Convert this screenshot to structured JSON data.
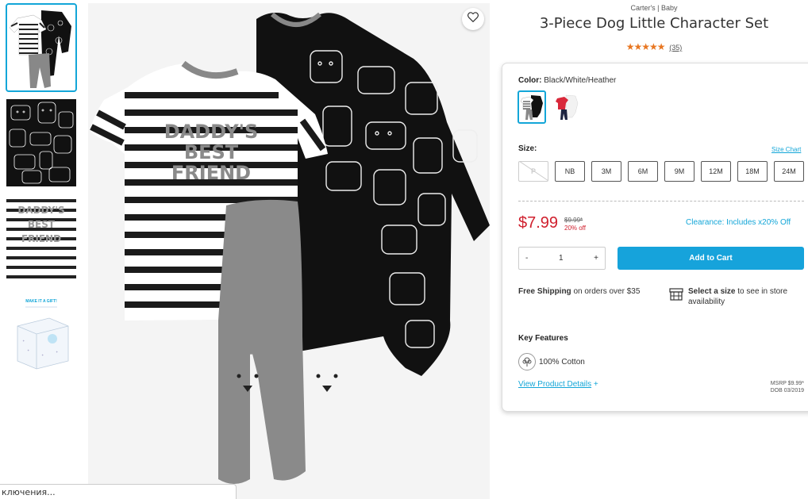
{
  "brand_line": "Carter's | Baby",
  "product": {
    "title": "3-Piece Dog Little Character Set",
    "stars": "★★★★★",
    "review_count": "(35)",
    "shirt_print": [
      "DADDY'S",
      "BEST",
      "FRIEND"
    ]
  },
  "thumbnails": [
    {
      "name": "thumb-set",
      "selected": true
    },
    {
      "name": "thumb-dog-print"
    },
    {
      "name": "thumb-shirt-print"
    },
    {
      "name": "thumb-gift-box",
      "caption": "MAKE IT A GIFT!"
    }
  ],
  "color": {
    "label": "Color:",
    "value": "Black/White/Heather"
  },
  "size": {
    "label": "Size:",
    "chart_link": "Size Chart",
    "options": [
      "P",
      "NB",
      "3M",
      "6M",
      "9M",
      "12M",
      "18M",
      "24M"
    ]
  },
  "pricing": {
    "price": "$7.99",
    "original": "$9.99*",
    "discount": "20% off",
    "clearance": "Clearance: Includes x20% Off"
  },
  "quantity": {
    "minus": "-",
    "value": "1",
    "plus": "+"
  },
  "add_to_cart": "Add to Cart",
  "shipping": {
    "bold": "Free Shipping",
    "rest": " on orders over $35"
  },
  "store": {
    "bold": "Select a size",
    "rest": " to see in store availability"
  },
  "features": {
    "label": "Key Features",
    "cotton": "100% Cotton",
    "details_link": "View Product Details",
    "details_plus": "+",
    "msrp": "MSRP $9.99*",
    "dob": "DOB 03/2019"
  },
  "status_bar": "ключения...",
  "colors": {
    "accent": "#16a3db",
    "price_red": "#d0202e",
    "star_orange": "#e87722"
  },
  "icons": [
    "heart-icon",
    "store-icon",
    "cotton-icon"
  ]
}
